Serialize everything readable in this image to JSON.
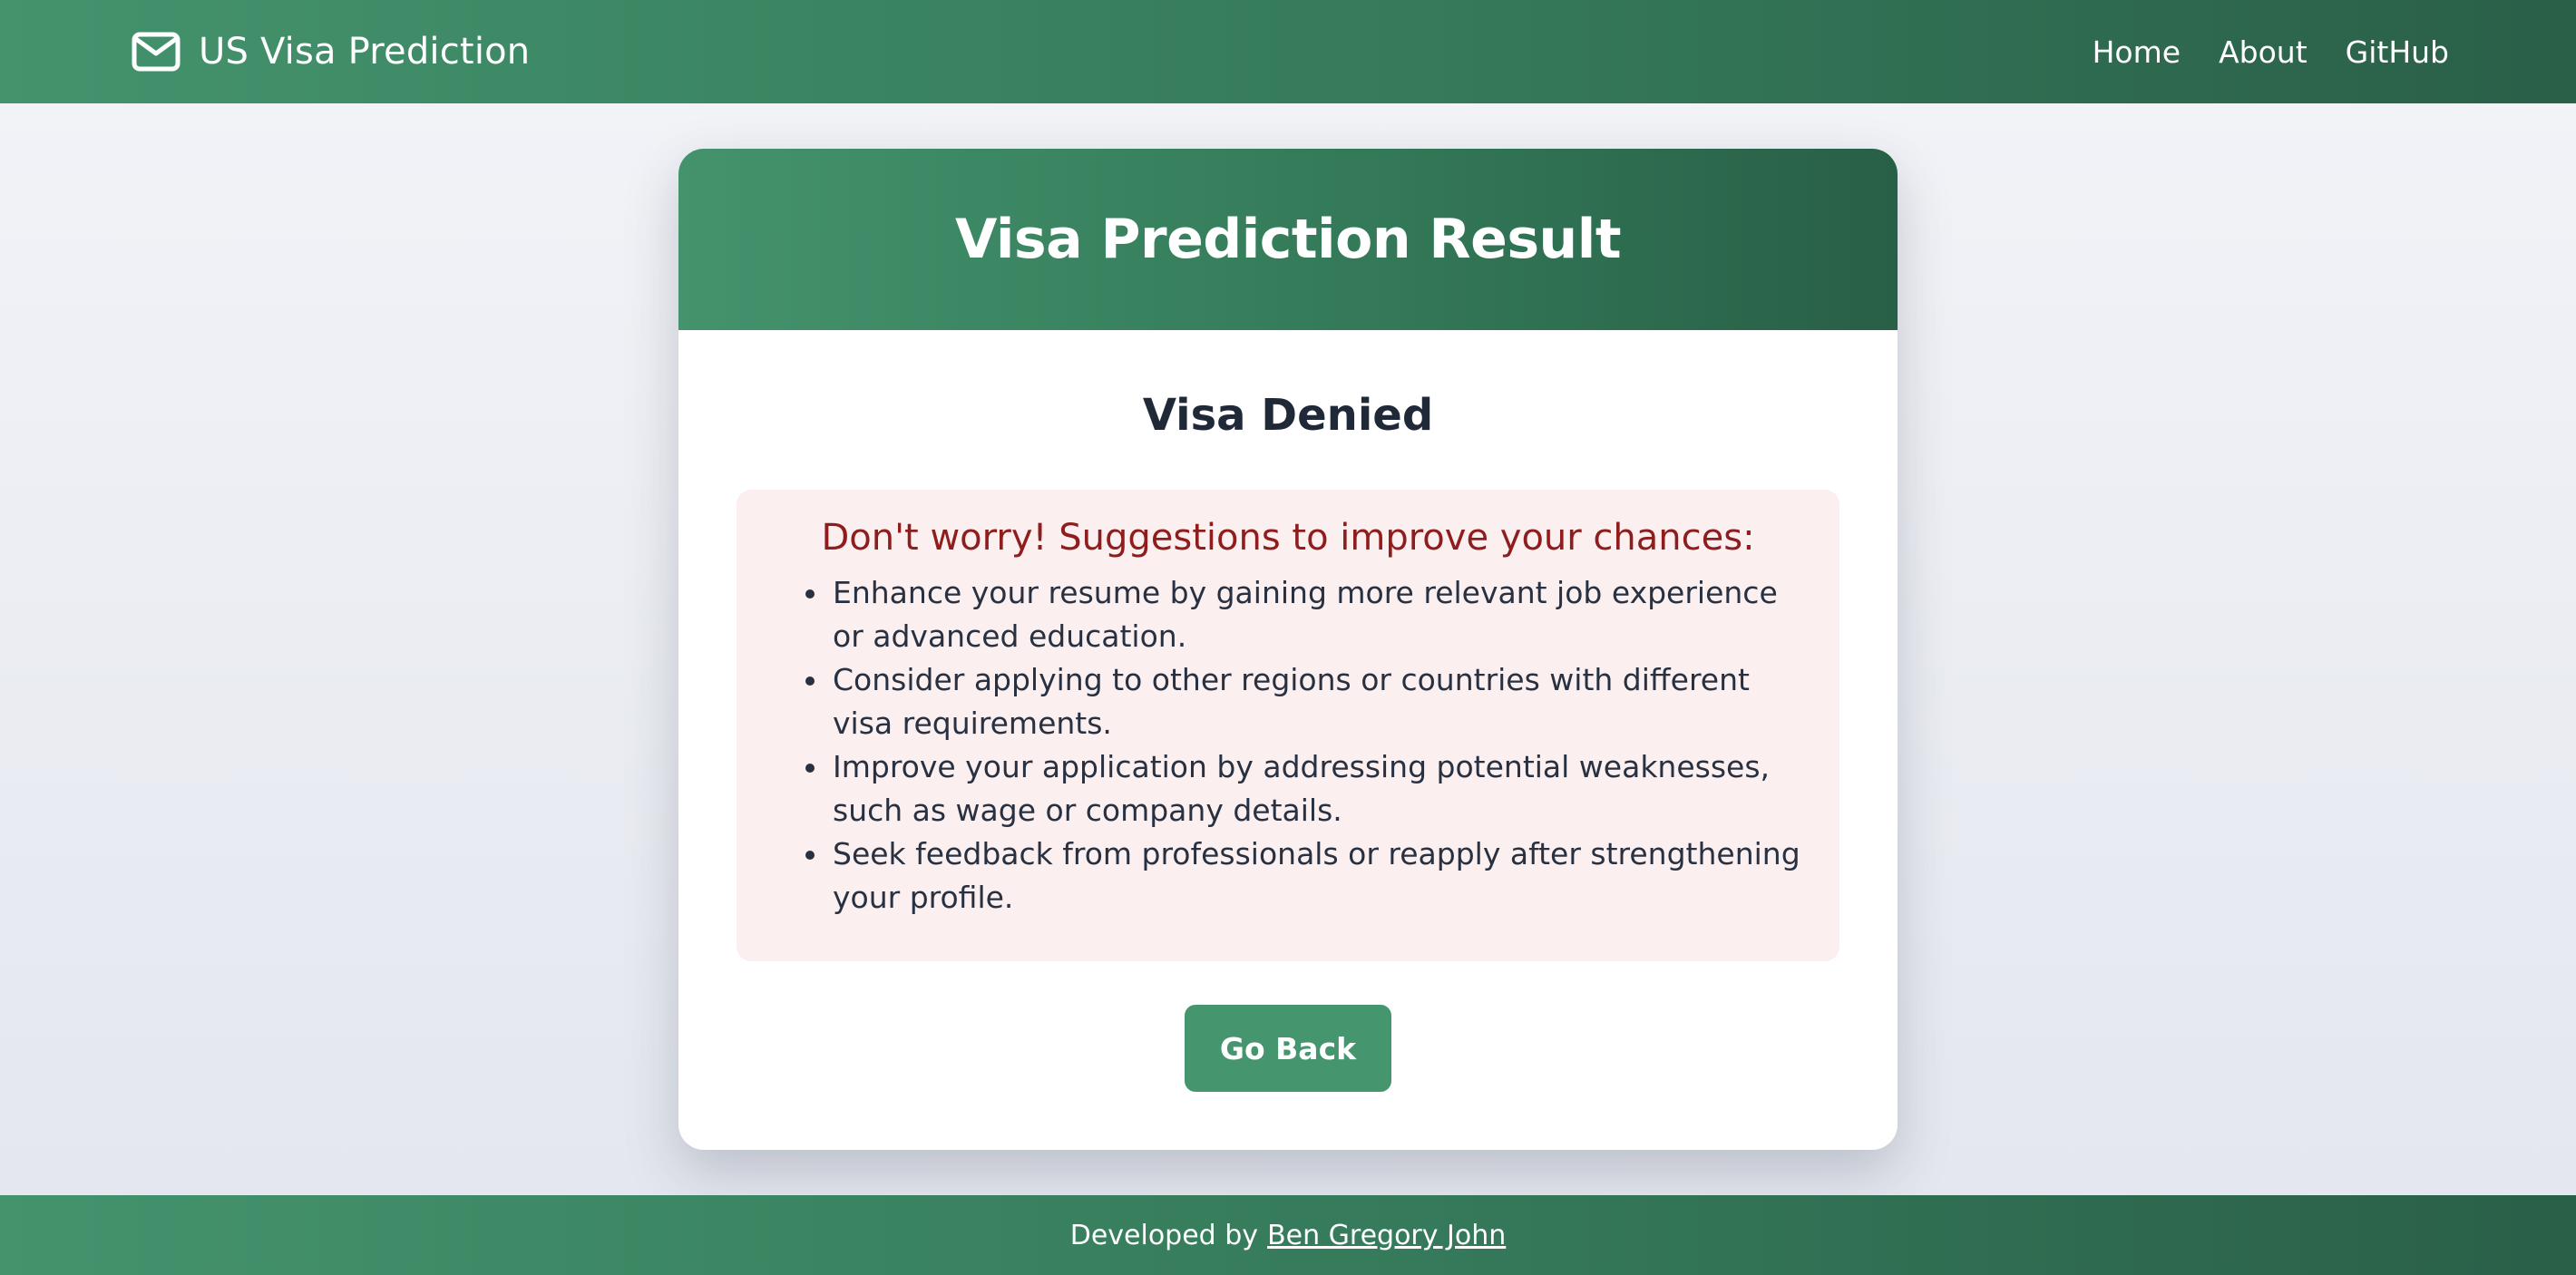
{
  "header": {
    "brand_icon": "envelope-icon",
    "brand_text": "US Visa Prediction",
    "nav": [
      "Home",
      "About",
      "GitHub"
    ]
  },
  "card": {
    "title": "Visa Prediction Result",
    "status": "Visa Denied",
    "suggestions": {
      "title": "Don't worry! Suggestions to improve your chances:",
      "items": [
        "Enhance your resume by gaining more relevant job experience or advanced education.",
        "Consider applying to other regions or countries with different visa requirements.",
        "Improve your application by addressing potential weaknesses, such as wage or company details.",
        "Seek feedback from professionals or reapply after strengthening your profile."
      ]
    },
    "back_button": "Go Back"
  },
  "footer": {
    "prefix": "Developed by",
    "author": "Ben Gregory John"
  },
  "colors": {
    "brand_green": "#44936d",
    "brand_green_dark": "#285f47",
    "denied_box": "#fcefef",
    "denied_text": "#8f1d1d"
  }
}
